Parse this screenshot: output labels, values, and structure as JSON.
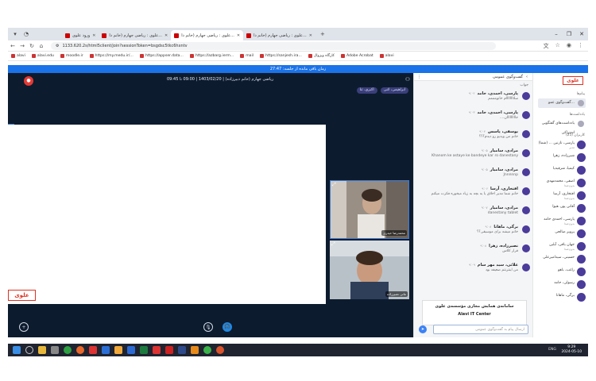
{
  "browser": {
    "tabs": [
      {
        "label": "ورود علوی"
      },
      {
        "label": "علوی : ریاضی جهارم (خانم دا..."
      },
      {
        "label": "علوی : ریاضی جهارم (خانم دا..."
      },
      {
        "label": "علوی : ریاضی جهارم (خانم دا..."
      }
    ],
    "url": "1133.620.2s/html5client/join?sessionToken=bsgdsc5tkc6hxntv",
    "bookmarks": [
      "alavi",
      "alavi.edu",
      "moodle.ir",
      "https://my.medu.ir/...",
      "https://appser.data...",
      "https://azbarg.ierm...",
      "mail",
      "https://sanjesh.ira...",
      "کارگاه ویژوال",
      "Adobe Acrobat",
      "alavi"
    ]
  },
  "banner": {
    "text": "زمان باقی مانده از جلسه: 27:47"
  },
  "session": {
    "info": "ریاضی جهارم (خانم دبیرزاده) | 1403/02/20 | 09:00 تا 09:45"
  },
  "chips": [
    "اکبری، ثنا",
    "ابراهیمی، اثنی"
  ],
  "videos": [
    {
      "label": "محمدرضا حیدری"
    },
    {
      "label": "مانی نصیرزاده"
    }
  ],
  "chat": {
    "title": "گفت‌وگوی عمومی",
    "messages": [
      {
        "name": "",
        "time": "",
        "text": "جواب"
      },
      {
        "name": "پارسی، احمدی، حامد",
        "time": "۹:۰۲",
        "text": "سلاااااااام خانومممم"
      },
      {
        "name": "پارسی، احمدی، حامد",
        "time": "۹:۰۳",
        "text": "....جااااااااان"
      },
      {
        "name": "یوسفی، پاسس",
        "time": "۹:۰۴",
        "text": "خانم من ویدیو رو دیدم؟؟؟"
      },
      {
        "name": "مرادی، سامیار",
        "time": "۹:۰۵",
        "text": "Khanom ke astaye ke bandeye kar ro danestany"
      },
      {
        "name": "مرادی، سامیار",
        "time": "۹:۰۵",
        "text": "Jnnnnnp"
      },
      {
        "name": "افتخاری، آرسا",
        "time": "۹:۰۶",
        "text": "خانم شما مدیر اخلاق یا یه بچه به زیاد میخوره فکرت میکنم"
      },
      {
        "name": "مرادی، سامیار",
        "time": "۹:۰۷",
        "text": "danestany tablet"
      },
      {
        "name": "برگی، ماهانا",
        "time": "۹:۰۸",
        "text": "خانم میشه برای موسیقی؟؟"
      },
      {
        "name": "نصیرزاده، زهرا",
        "time": "۹:۰۸",
        "text": "قرار کلاس"
      },
      {
        "name": "علائی، سید مهر سام",
        "time": "۹:۰۹",
        "text": "من اینترنتم ضعیفه بود"
      }
    ],
    "ad_title": "سامانه‌ی همایش مجازی مؤسسه‌ی علوی",
    "ad_sub": "Alavi IT Center",
    "input_placeholder": "ارسال پیام به گفت‌وگوی عمومی"
  },
  "people": {
    "brand": "علوی",
    "section_messages": "پیام‌ها",
    "public_chat": "گفت‌وگوی عمو...",
    "section_notes": "یادداشت‌ها",
    "notes_item": "یادداشت‌های گفتگویی اشتراکی",
    "users_header": "کاربران (25)",
    "list": [
      {
        "name": "پارسی، نازنین ... (شما)",
        "sub": "مدیر"
      },
      {
        "name": "شیرزاده، زهرا",
        "sub": ""
      },
      {
        "name": "کیمیا، شرقیه‌یا",
        "sub": ""
      },
      {
        "name": "اصفی، محمدمهدی",
        "sub": "بدون‌صدا"
      },
      {
        "name": "افتخاری، آرسا",
        "sub": "بدون‌صدا"
      },
      {
        "name": "آقانی پور، هیوا",
        "sub": ""
      },
      {
        "name": "پارسی، احمدی حامد",
        "sub": "بدون‌صدا"
      },
      {
        "name": "پرویز صالحی",
        "sub": ""
      },
      {
        "name": "جهان یاقی، آیلین",
        "sub": "بدون‌صدا"
      },
      {
        "name": "حسینی، سیدامیرعلی",
        "sub": ""
      },
      {
        "name": "راغب، باهو",
        "sub": ""
      },
      {
        "name": "رسولی، حامد",
        "sub": ""
      },
      {
        "name": "برگی، ماهانا",
        "sub": ""
      }
    ]
  },
  "taskbar": {
    "time": "9:29",
    "date": "2024-05-10",
    "tray": "ENG"
  }
}
